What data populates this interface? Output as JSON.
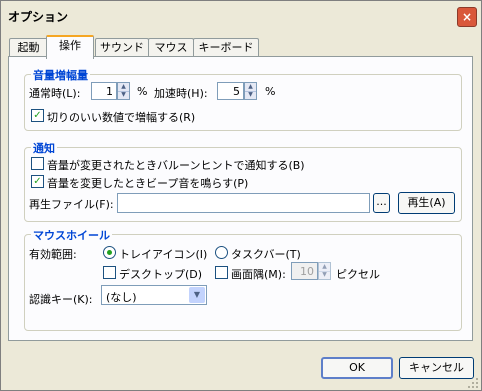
{
  "window": {
    "title": "オプション"
  },
  "icons": {
    "close": "×",
    "spin_up": "▲",
    "spin_down": "▼",
    "dropdown": "▼",
    "check": "✓"
  },
  "tabs": [
    {
      "label": "起動",
      "active": false
    },
    {
      "label": "操作",
      "active": true
    },
    {
      "label": "サウンド",
      "active": false
    },
    {
      "label": "マウス",
      "active": false
    },
    {
      "label": "キーボード",
      "active": false
    }
  ],
  "volume": {
    "legend": "音量増幅量",
    "normal_label": "通常時(L):",
    "normal_value": "1",
    "normal_unit": "%",
    "accel_label": "加速時(H):",
    "accel_value": "5",
    "accel_unit": "%",
    "round_label": "切りのいい数値で増幅する(R)",
    "round_checked": true
  },
  "notify": {
    "legend": "通知",
    "balloon_label": "音量が変更されたときバルーンヒントで通知する(B)",
    "balloon_checked": false,
    "beep_label": "音量を変更したときビープ音を鳴らす(P)",
    "beep_checked": true,
    "file_label": "再生ファイル(F):",
    "file_value": "",
    "browse_label": "...",
    "play_label": "再生(A)"
  },
  "wheel": {
    "legend": "マウスホイール",
    "range_label": "有効範囲:",
    "tray_label": "トレイアイコン(I)",
    "taskbar_label": "タスクバー(T)",
    "desktop_label": "デスクトップ(D)",
    "corner_label": "画面隅(M):",
    "corner_value": "10",
    "pixel_label": "ピクセル",
    "key_label": "認識キー(K):",
    "key_value": "(なし)"
  },
  "footer": {
    "ok_label": "OK",
    "cancel_label": "キャンセル"
  }
}
